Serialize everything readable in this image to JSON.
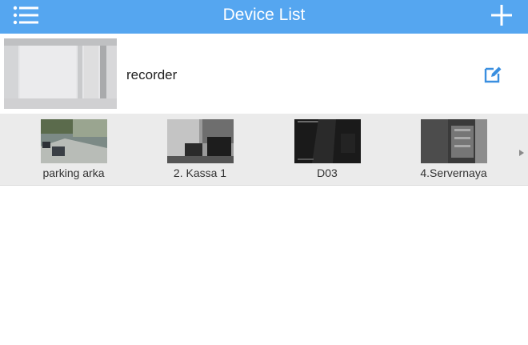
{
  "header": {
    "title": "Device List",
    "menu_icon": "menu-list-icon",
    "add_icon": "plus-icon"
  },
  "device": {
    "name": "recorder",
    "edit_icon": "edit-pencil-icon"
  },
  "channels": [
    {
      "label": "parking arka"
    },
    {
      "label": "2. Kassa 1"
    },
    {
      "label": "D03"
    },
    {
      "label": "4.Servernaya"
    }
  ],
  "channels_more_icon": "chevron-right-icon",
  "colors": {
    "header_bg": "#55a6f0",
    "accent": "#3a8fe0",
    "channel_strip_bg": "#ebebeb"
  }
}
